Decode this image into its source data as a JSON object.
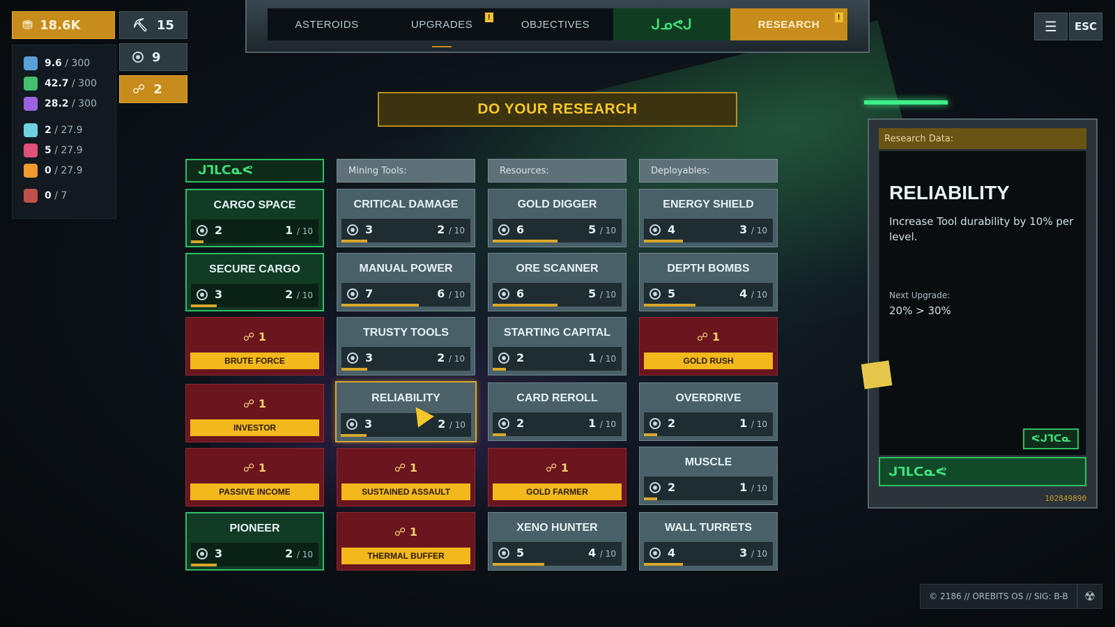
{
  "top_left": {
    "gold": "18.6K",
    "picks": "15",
    "research_points": "9",
    "relics": "2"
  },
  "resources": [
    {
      "value": "9.6",
      "max": " / 300",
      "color": "#5aa0d8"
    },
    {
      "value": "42.7",
      "max": " / 300",
      "color": "#44c070"
    },
    {
      "value": "28.2",
      "max": " / 300",
      "color": "#9a62e0"
    },
    {
      "value": "2",
      "max": " / 27.9",
      "color": "#6fd0e0"
    },
    {
      "value": "5",
      "max": " / 27.9",
      "color": "#e0507a"
    },
    {
      "value": "0",
      "max": " / 27.9",
      "color": "#f09a30"
    },
    {
      "value": "0",
      "max": " / 7",
      "color": "#c0504a"
    }
  ],
  "nav": {
    "tabs": [
      "ASTEROIDS",
      "UPGRADES",
      "OBJECTIVES",
      "ᒍᓄᕙᒍ",
      "RESEARCH"
    ]
  },
  "esc_label": "ESC",
  "banner": "DO YOUR RESEARCH",
  "columns": {
    "alien": "ᒍᒣᒪᑕᓇᕙ",
    "mining": "Mining Tools:",
    "resources": "Resources:",
    "deployables": "Deployables:"
  },
  "cards": {
    "cargo_space": {
      "title": "CARGO SPACE",
      "cost": "2",
      "level": "1",
      "max": "/ 10",
      "progress": 0.1
    },
    "secure_cargo": {
      "title": "SECURE CARGO",
      "cost": "3",
      "level": "2",
      "max": "/ 10",
      "progress": 0.2
    },
    "brute_force": {
      "cost": "1",
      "label": "BRUTE FORCE"
    },
    "investor": {
      "cost": "1",
      "label": "INVESTOR"
    },
    "passive_income": {
      "cost": "1",
      "label": "PASSIVE INCOME"
    },
    "pioneer": {
      "title": "PIONEER",
      "cost": "3",
      "level": "2",
      "max": "/ 10",
      "progress": 0.2
    },
    "critical_damage": {
      "title": "CRITICAL DAMAGE",
      "cost": "3",
      "level": "2",
      "max": "/ 10",
      "progress": 0.2
    },
    "manual_power": {
      "title": "MANUAL POWER",
      "cost": "7",
      "level": "6",
      "max": "/ 10",
      "progress": 0.6
    },
    "trusty_tools": {
      "title": "TRUSTY TOOLS",
      "cost": "3",
      "level": "2",
      "max": "/ 10",
      "progress": 0.2
    },
    "reliability": {
      "title": "RELIABILITY",
      "cost": "3",
      "level": "2",
      "max": "/ 10",
      "progress": 0.2
    },
    "sustained_assault": {
      "cost": "1",
      "label": "SUSTAINED ASSAULT"
    },
    "thermal_buffer": {
      "cost": "1",
      "label": "THERMAL BUFFER"
    },
    "gold_digger": {
      "title": "GOLD DIGGER",
      "cost": "6",
      "level": "5",
      "max": "/ 10",
      "progress": 0.5
    },
    "ore_scanner": {
      "title": "ORE SCANNER",
      "cost": "6",
      "level": "5",
      "max": "/ 10",
      "progress": 0.5
    },
    "starting_capital": {
      "title": "STARTING CAPITAL",
      "cost": "2",
      "level": "1",
      "max": "/ 10",
      "progress": 0.1
    },
    "card_reroll": {
      "title": "CARD REROLL",
      "cost": "2",
      "level": "1",
      "max": "/ 10",
      "progress": 0.1
    },
    "gold_farmer": {
      "cost": "1",
      "label": "GOLD FARMER"
    },
    "xeno_hunter": {
      "title": "XENO HUNTER",
      "cost": "5",
      "level": "4",
      "max": "/ 10",
      "progress": 0.4
    },
    "energy_shield": {
      "title": "ENERGY SHIELD",
      "cost": "4",
      "level": "3",
      "max": "/ 10",
      "progress": 0.3
    },
    "depth_bombs": {
      "title": "DEPTH BOMBS",
      "cost": "5",
      "level": "4",
      "max": "/ 10",
      "progress": 0.4
    },
    "gold_rush": {
      "cost": "1",
      "label": "GOLD RUSH"
    },
    "overdrive": {
      "title": "OVERDRIVE",
      "cost": "2",
      "level": "1",
      "max": "/ 10",
      "progress": 0.1
    },
    "muscle": {
      "title": "MUSCLE",
      "cost": "2",
      "level": "1",
      "max": "/ 10",
      "progress": 0.1
    },
    "wall_turrets": {
      "title": "WALL TURRETS",
      "cost": "4",
      "level": "3",
      "max": "/ 10",
      "progress": 0.3
    }
  },
  "panel": {
    "header": "Research Data:",
    "title": "RELIABILITY",
    "description": "Increase Tool durability by 10% per level.",
    "next_label": "Next Upgrade:",
    "next_values": "20% > 30%",
    "button": "ᕙᒍᒣᑕᓇ",
    "footer": "ᒍᒣᒪᑕᓇᕙ",
    "id": "102849890"
  },
  "footer_text": "© 2186 // OREBITS OS // SIG: B-B"
}
